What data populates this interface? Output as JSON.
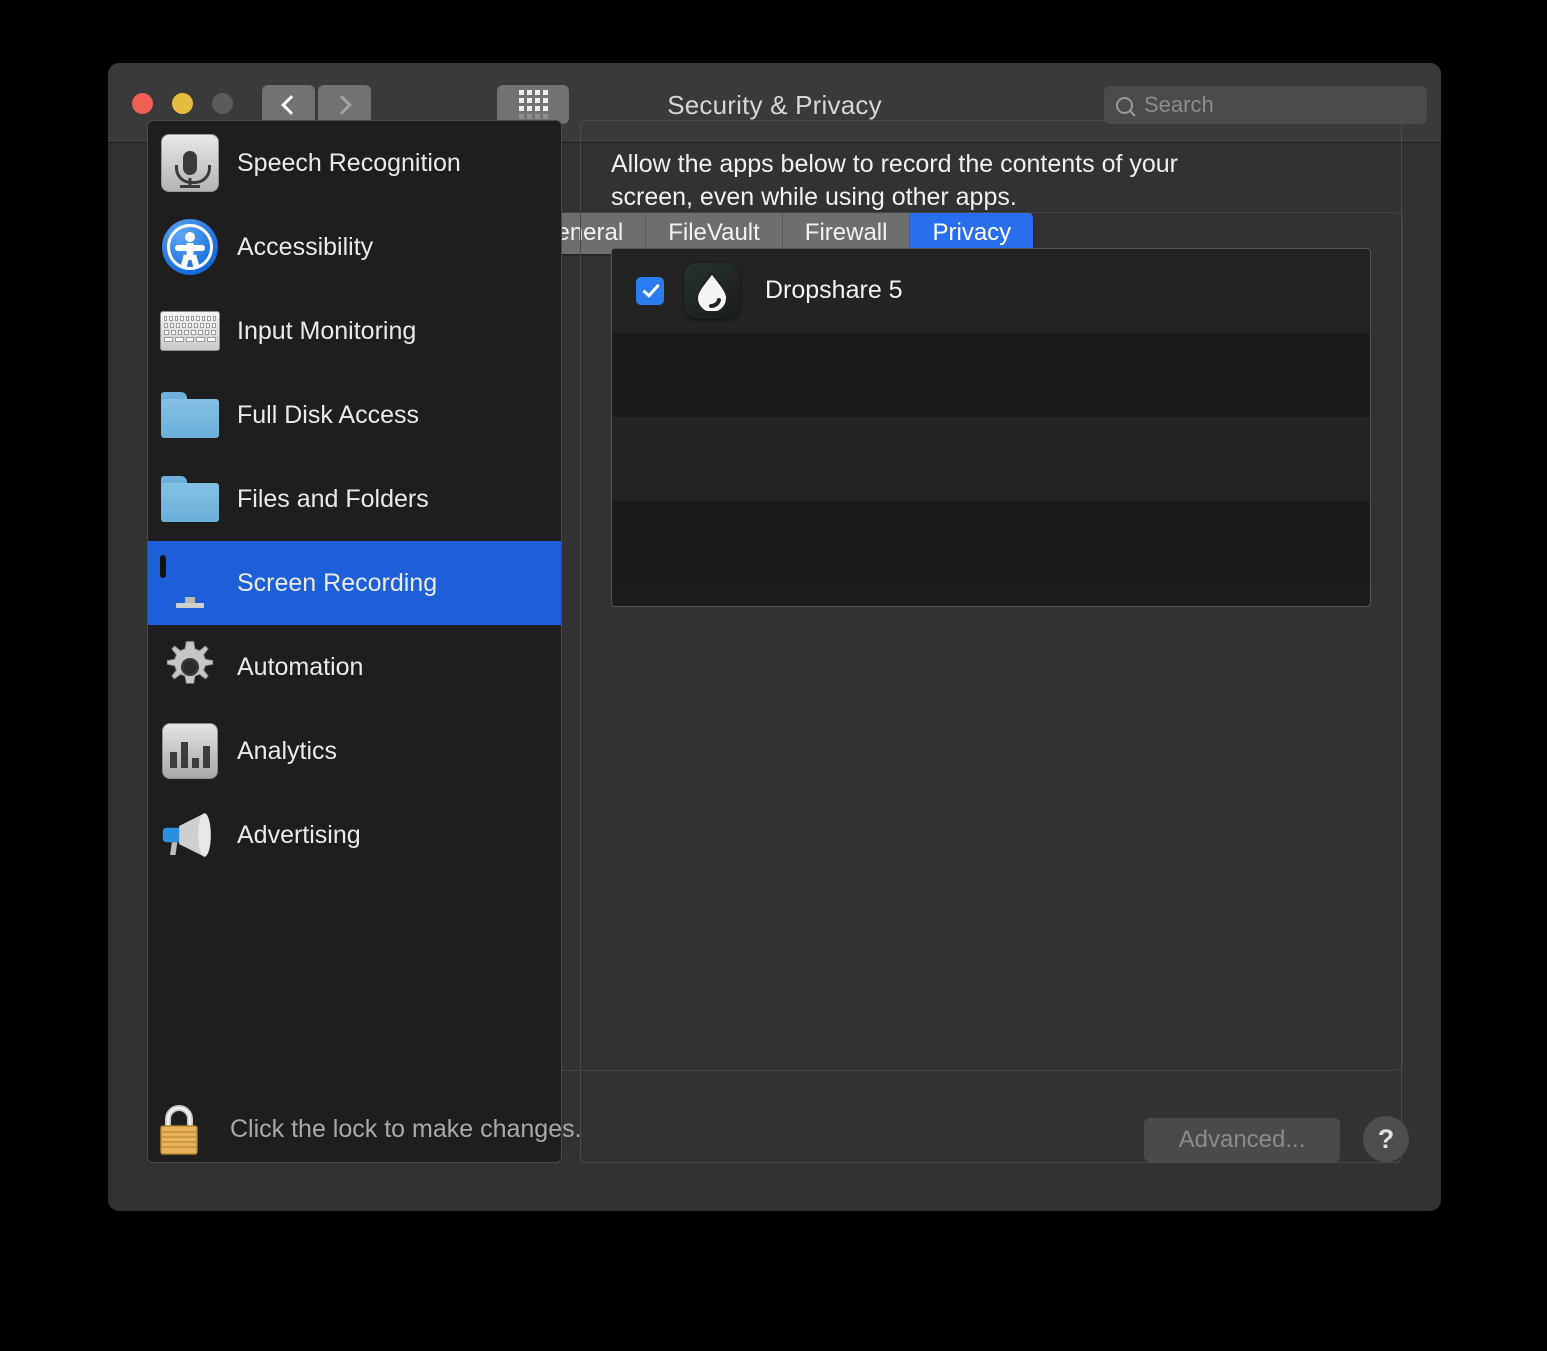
{
  "window": {
    "title": "Security & Privacy",
    "traffic_lights": [
      {
        "name": "close",
        "color": "#ee5f56"
      },
      {
        "name": "minimize",
        "color": "#e4bd40"
      },
      {
        "name": "zoom",
        "color": "#5b5b5b"
      }
    ],
    "nav": {
      "back_icon": "chevron-left-icon",
      "forward_icon": "chevron-right-icon",
      "grid_icon": "show-all-grid-icon"
    },
    "search": {
      "placeholder": "Search",
      "value": "",
      "icon": "search-icon"
    }
  },
  "tabs": [
    {
      "label": "General",
      "active": false
    },
    {
      "label": "FileVault",
      "active": false
    },
    {
      "label": "Firewall",
      "active": false
    },
    {
      "label": "Privacy",
      "active": true
    }
  ],
  "sidebar": {
    "items": [
      {
        "label": "Speech Recognition",
        "icon": "microphone-icon",
        "selected": false
      },
      {
        "label": "Accessibility",
        "icon": "accessibility-icon",
        "selected": false
      },
      {
        "label": "Input Monitoring",
        "icon": "keyboard-icon",
        "selected": false
      },
      {
        "label": "Full Disk Access",
        "icon": "folder-icon",
        "selected": false
      },
      {
        "label": "Files and Folders",
        "icon": "folder-icon",
        "selected": false
      },
      {
        "label": "Screen Recording",
        "icon": "monitor-icon",
        "selected": true
      },
      {
        "label": "Automation",
        "icon": "gear-icon",
        "selected": false
      },
      {
        "label": "Analytics",
        "icon": "bar-chart-icon",
        "selected": false
      },
      {
        "label": "Advertising",
        "icon": "megaphone-icon",
        "selected": false
      }
    ]
  },
  "detail": {
    "description": "Allow the apps below to record the contents of your screen, even while using other apps.",
    "apps": [
      {
        "name": "Dropshare 5",
        "checked": true,
        "icon": "dropshare-droplet-icon"
      }
    ],
    "empty_row_count": 3
  },
  "bottom": {
    "lock_icon": "padlock-closed-icon",
    "lock_note": "Click the lock to make changes.",
    "advanced_label": "Advanced...",
    "advanced_disabled": true,
    "help_label": "?"
  },
  "colors": {
    "accent_blue": "#2a6ef0",
    "selection_blue": "#1d5fd8",
    "checkbox_blue": "#2b7cf0",
    "window_bg": "#323232",
    "titlebar_bg": "#3a3a3a",
    "sidebar_bg": "#1e1e1e",
    "list_bg": "#1c1c1c"
  }
}
